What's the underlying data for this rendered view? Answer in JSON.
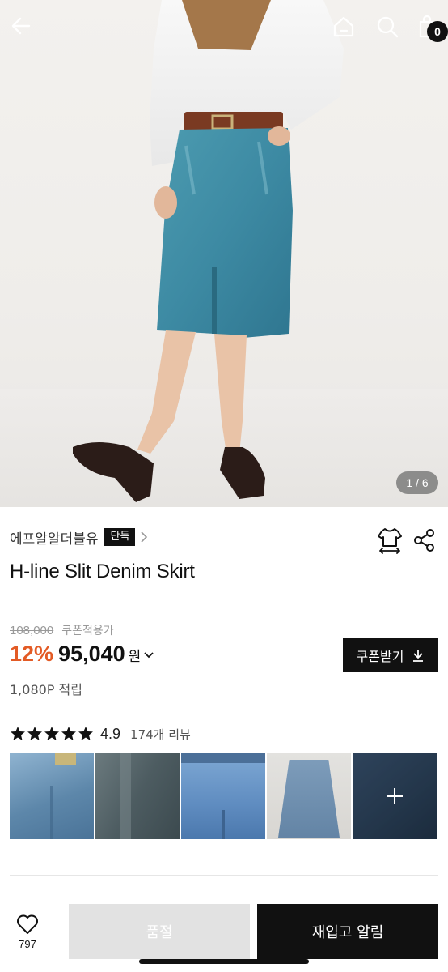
{
  "header": {
    "back_icon": "arrow-left-icon",
    "home_icon": "home-icon",
    "search_icon": "search-icon",
    "cart_icon": "shopping-bag-icon",
    "cart_count": "0"
  },
  "gallery": {
    "pager": "1 / 6"
  },
  "product": {
    "brand": "에프알알더블유",
    "brand_tag": "단독",
    "title": "H-line Slit Denim Skirt",
    "original_price": "108,000",
    "coupon_note": "쿠폰적용가",
    "discount": "12%",
    "sale_price": "95,040",
    "currency": "원",
    "points": "1,080P 적립",
    "coupon_button": "쿠폰받기"
  },
  "reviews": {
    "rating": "4.9",
    "link": "174개 리뷰",
    "stars": 5
  },
  "bottom": {
    "like_count": "797",
    "soldout_label": "품절",
    "restock_label": "재입고 알림"
  },
  "colors": {
    "accent": "#e35b25",
    "primary": "#111111",
    "disabled": "#e2e2e2"
  }
}
